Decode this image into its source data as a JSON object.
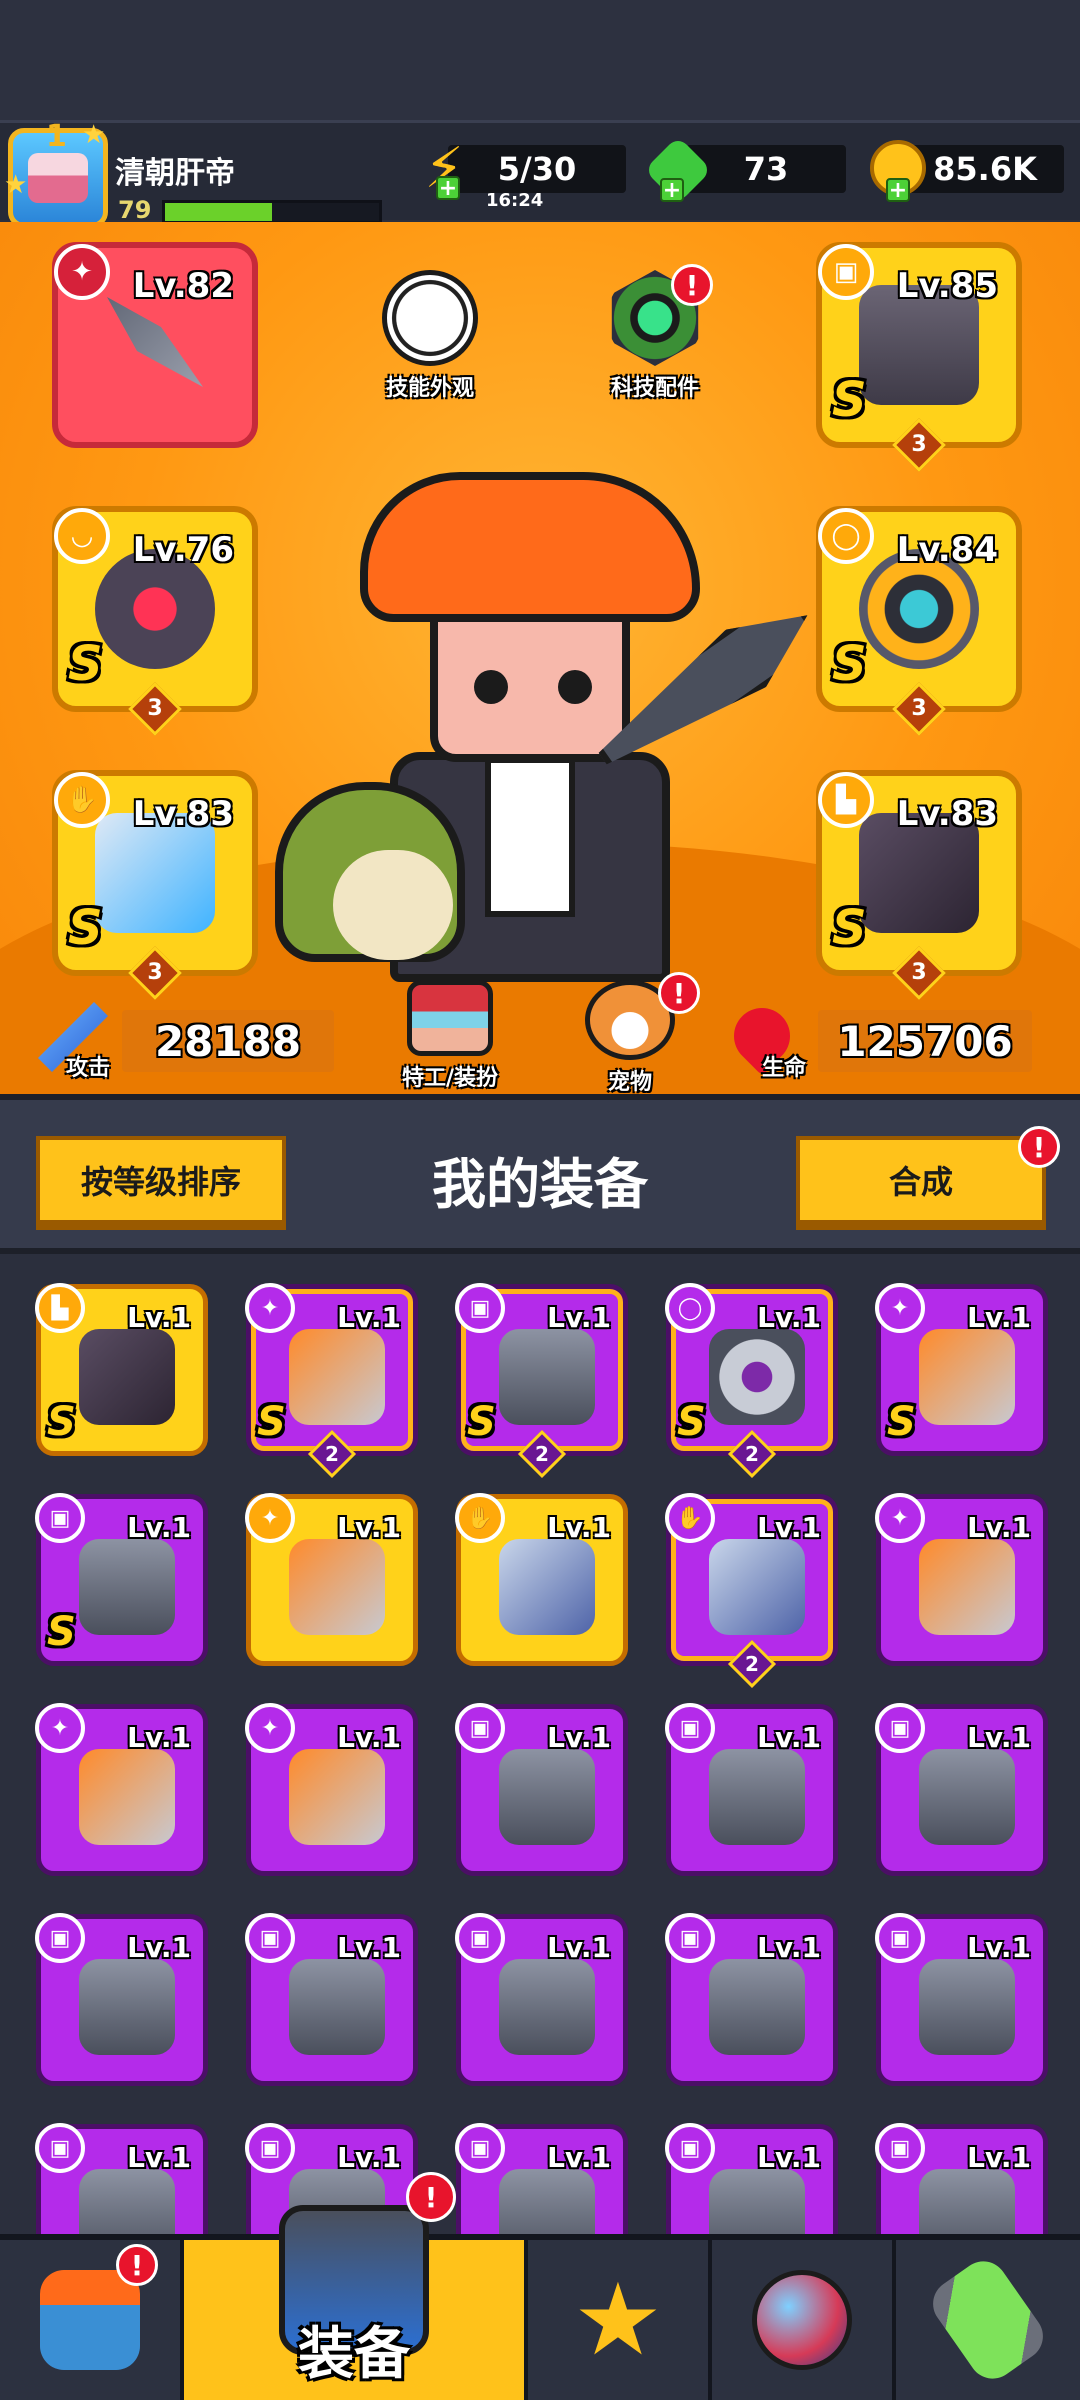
{
  "header": {
    "player_name": "清朝肝帝",
    "player_level": "79",
    "xp_fraction": 0.5,
    "avatar_rank": "1",
    "energy": "5/30",
    "energy_timer": "16:24",
    "gems": "73",
    "gold": "85.6K"
  },
  "loadout": {
    "slots": [
      {
        "level": "Lv.82",
        "rank": "",
        "stars": "",
        "color": "red",
        "icon": "weapon-icon"
      },
      {
        "level": "Lv.85",
        "rank": "S",
        "stars": "3",
        "color": "gold",
        "icon": "armor-icon"
      },
      {
        "level": "Lv.76",
        "rank": "S",
        "stars": "3",
        "color": "gold",
        "icon": "necklace-icon"
      },
      {
        "level": "Lv.84",
        "rank": "S",
        "stars": "3",
        "color": "gold",
        "icon": "belt-icon"
      },
      {
        "level": "Lv.83",
        "rank": "S",
        "stars": "3",
        "color": "gold",
        "icon": "glove-icon"
      },
      {
        "level": "Lv.83",
        "rank": "S",
        "stars": "3",
        "color": "gold",
        "icon": "boot-icon"
      }
    ],
    "skill_skin_label": "技能外观",
    "tech_parts_label": "科技配件",
    "agent_outfit_label": "特工/装扮",
    "pet_label": "宠物",
    "attack_label": "攻击",
    "attack_value": "28188",
    "hp_label": "生命",
    "hp_value": "125706"
  },
  "toolbar": {
    "sort_label": "按等级排序",
    "title": "我的装备",
    "merge_label": "合成"
  },
  "inventory": [
    {
      "level": "Lv.1",
      "rank": "S",
      "stars": "",
      "color": "gold",
      "icon": "boot-icon"
    },
    {
      "level": "Lv.1",
      "rank": "S",
      "stars": "2",
      "color": "purple",
      "icon": "weapon-icon"
    },
    {
      "level": "Lv.1",
      "rank": "S",
      "stars": "2",
      "color": "purple",
      "icon": "armor-icon"
    },
    {
      "level": "Lv.1",
      "rank": "S",
      "stars": "2",
      "color": "purple",
      "icon": "belt-icon"
    },
    {
      "level": "Lv.1",
      "rank": "S",
      "stars": "",
      "color": "purple",
      "icon": "weapon-icon"
    },
    {
      "level": "Lv.1",
      "rank": "S",
      "stars": "",
      "color": "purple",
      "icon": "armor-icon"
    },
    {
      "level": "Lv.1",
      "rank": "",
      "stars": "",
      "color": "gold",
      "icon": "weapon-icon"
    },
    {
      "level": "Lv.1",
      "rank": "",
      "stars": "",
      "color": "gold",
      "icon": "glove-icon"
    },
    {
      "level": "Lv.1",
      "rank": "",
      "stars": "2",
      "color": "purple",
      "icon": "glove-icon"
    },
    {
      "level": "Lv.1",
      "rank": "",
      "stars": "",
      "color": "purple",
      "icon": "weapon-icon"
    },
    {
      "level": "Lv.1",
      "rank": "",
      "stars": "",
      "color": "purple",
      "icon": "weapon-icon"
    },
    {
      "level": "Lv.1",
      "rank": "",
      "stars": "",
      "color": "purple",
      "icon": "weapon-icon"
    },
    {
      "level": "Lv.1",
      "rank": "",
      "stars": "",
      "color": "purple",
      "icon": "armor-icon"
    },
    {
      "level": "Lv.1",
      "rank": "",
      "stars": "",
      "color": "purple",
      "icon": "armor-icon"
    },
    {
      "level": "Lv.1",
      "rank": "",
      "stars": "",
      "color": "purple",
      "icon": "armor-icon"
    },
    {
      "level": "Lv.1",
      "rank": "",
      "stars": "",
      "color": "purple",
      "icon": "armor-icon"
    },
    {
      "level": "Lv.1",
      "rank": "",
      "stars": "",
      "color": "purple",
      "icon": "armor-icon"
    },
    {
      "level": "Lv.1",
      "rank": "",
      "stars": "",
      "color": "purple",
      "icon": "armor-icon"
    },
    {
      "level": "Lv.1",
      "rank": "",
      "stars": "",
      "color": "purple",
      "icon": "armor-icon"
    },
    {
      "level": "Lv.1",
      "rank": "",
      "stars": "",
      "color": "purple",
      "icon": "armor-icon"
    },
    {
      "level": "Lv.1",
      "rank": "",
      "stars": "",
      "color": "purple",
      "icon": "armor-icon"
    },
    {
      "level": "Lv.1",
      "rank": "",
      "stars": "",
      "color": "purple",
      "icon": "armor-icon"
    },
    {
      "level": "Lv.1",
      "rank": "",
      "stars": "",
      "color": "purple",
      "icon": "armor-icon"
    },
    {
      "level": "Lv.1",
      "rank": "",
      "stars": "",
      "color": "purple",
      "icon": "armor-icon"
    },
    {
      "level": "Lv.1",
      "rank": "",
      "stars": "",
      "color": "purple",
      "icon": "armor-icon"
    }
  ],
  "bottom_nav": {
    "tabs": [
      {
        "name": "shop",
        "label": "",
        "icon": "shop-icon"
      },
      {
        "name": "equipment",
        "label": "装备",
        "icon": "equipment-icon"
      },
      {
        "name": "battle",
        "label": "",
        "icon": "battle-star-icon"
      },
      {
        "name": "events",
        "label": "",
        "icon": "orb-icon"
      },
      {
        "name": "lab",
        "label": "",
        "icon": "dna-icon"
      }
    ]
  },
  "colors": {
    "gold": "#ffd21a",
    "purple": "#b42bea",
    "red": "#ff4f5f",
    "stage": "#ff9812",
    "alert": "#e8142c"
  }
}
